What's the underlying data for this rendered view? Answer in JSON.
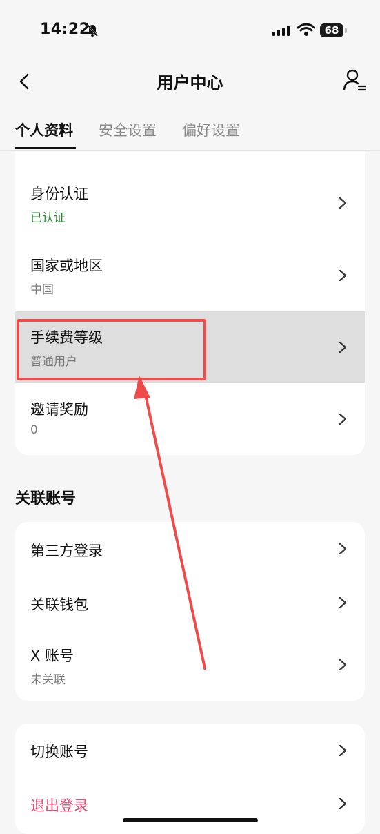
{
  "status": {
    "time": "14:22",
    "battery": "68"
  },
  "nav": {
    "title": "用户中心"
  },
  "tabs": [
    {
      "label": "个人资料"
    },
    {
      "label": "安全设置"
    },
    {
      "label": "偏好设置"
    }
  ],
  "profile": {
    "identity": {
      "title": "身份认证",
      "value": "已认证"
    },
    "region": {
      "title": "国家或地区",
      "value": "中国"
    },
    "fee_level": {
      "title": "手续费等级",
      "value": "普通用户"
    },
    "invite": {
      "title": "邀请奖励",
      "value": "0"
    }
  },
  "linked": {
    "section_title": "关联账号",
    "third_party": {
      "title": "第三方登录"
    },
    "wallet": {
      "title": "关联钱包"
    },
    "x_account": {
      "title": "X 账号",
      "value": "未关联"
    }
  },
  "account": {
    "switch": {
      "title": "切换账号"
    },
    "logout": {
      "title": "退出登录"
    }
  },
  "colors": {
    "verified": "#2e8a3a",
    "logout": "#e0527a",
    "annotation": "#ef4b4b"
  }
}
